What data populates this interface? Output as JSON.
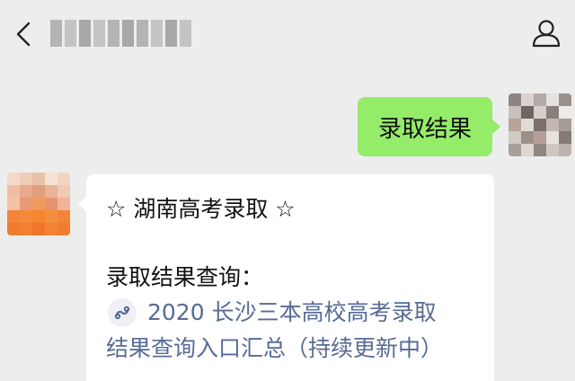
{
  "header": {
    "back_icon": "chevron-left-icon",
    "profile_icon": "person-icon",
    "title_pixelated": true
  },
  "messages": {
    "outgoing": {
      "text": "录取结果",
      "bubble_color": "#95ec69"
    },
    "incoming": {
      "heading": "☆ 湖南高考录取 ☆",
      "subheading": "录取结果查询：",
      "link_icon": "mini-program-icon",
      "link_line1": "2020 长沙三本高校高考录取",
      "link_line2": "结果查询入口汇总（持续更新中）",
      "link_color": "#576b95"
    }
  }
}
